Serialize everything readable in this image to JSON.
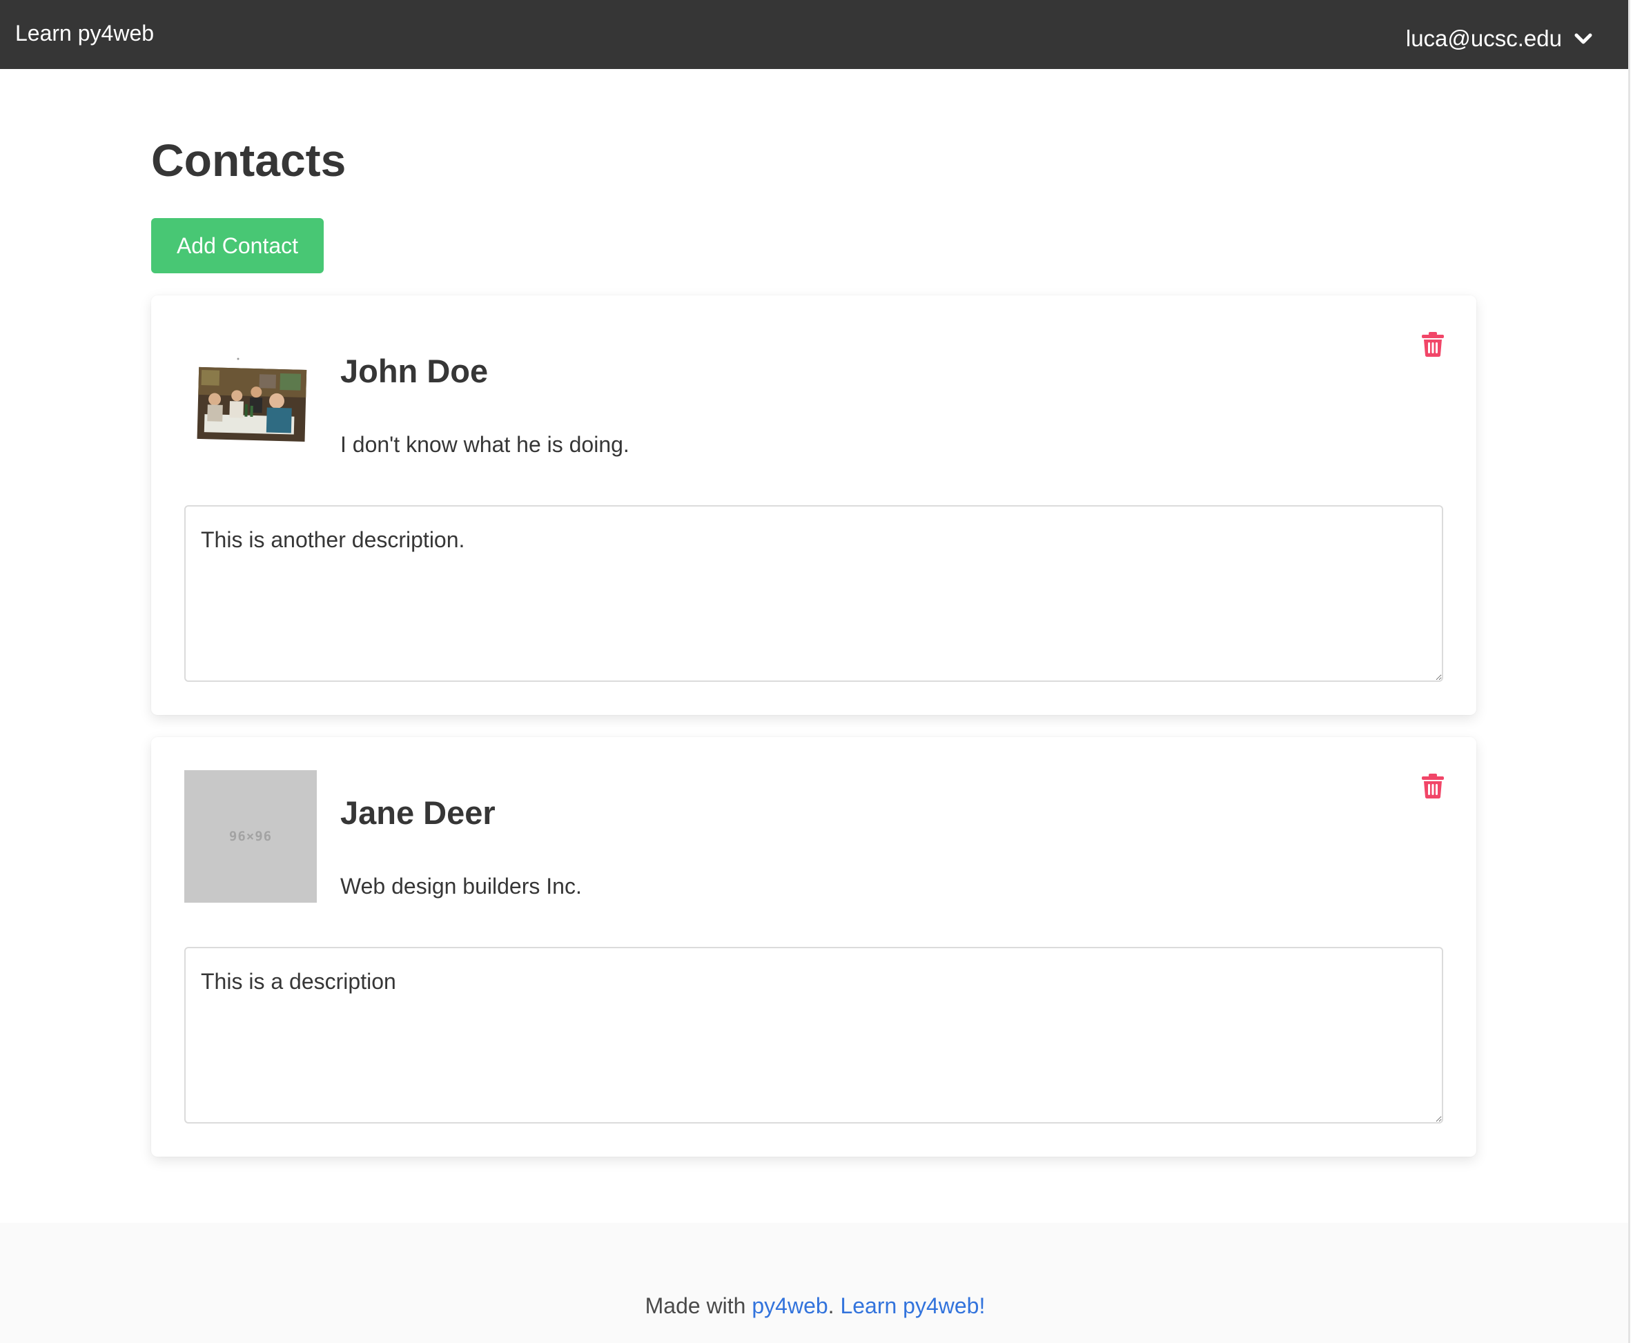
{
  "navbar": {
    "brand": "Learn py4web",
    "user_email": "luca@ucsc.edu",
    "dropdown_icon": "chevron-down-icon"
  },
  "main": {
    "title": "Contacts",
    "add_button_label": "Add Contact"
  },
  "contacts": [
    {
      "name": "John Doe",
      "affiliation": "I don't know what he is doing.",
      "description": "This is another description.",
      "avatar": "photo",
      "delete_icon": "trash-icon"
    },
    {
      "name": "Jane Deer",
      "affiliation": "Web design builders Inc.",
      "description": "This is a description",
      "avatar": "placeholder",
      "avatar_placeholder_text": "96×96",
      "delete_icon": "trash-icon"
    }
  ],
  "footer": {
    "prefix": "Made with ",
    "link1": "py4web",
    "separator": ". ",
    "link2": "Learn py4web!"
  },
  "colors": {
    "navbar_bg": "#363636",
    "primary_green": "#48c774",
    "danger_red": "#f14668",
    "link_blue": "#3273dc",
    "footer_bg": "#fafafa"
  }
}
